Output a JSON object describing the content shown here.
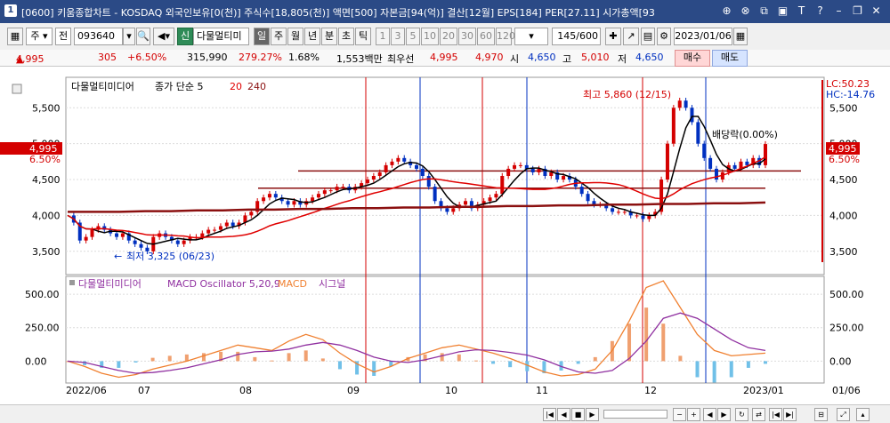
{
  "window": {
    "icon_label": "1",
    "title": "[0600] 키움종합차트 - KOSDAQ 외국인보유[0(천)] 주식수[18,805(천)] 액면[500] 자본금[94(억)] 결산[12월] EPS[184] PER[27.11] 시가총액[93"
  },
  "toolbar": {
    "stock_code": "093640",
    "stock_name": "다물멀티미",
    "new_badge": "신",
    "mode_label": "주",
    "prev_label": "전",
    "periods": [
      "일",
      "주",
      "월",
      "년",
      "분",
      "초",
      "틱"
    ],
    "intervals": [
      "1",
      "3",
      "5",
      "10",
      "20",
      "30",
      "60",
      "120"
    ],
    "count_value": "145",
    "count_total": "/600",
    "date_value": "2023/01/06"
  },
  "quote": {
    "price": "4,995",
    "change": "305",
    "change_pct": "+6.50%",
    "volume": "315,990",
    "volume_pct": "279.27%",
    "turnover": "1.68%",
    "amount": "1,553백만",
    "best_ask_label": "최우선",
    "best_ask": "4,995",
    "best_bid": "4,970",
    "open_label": "시",
    "open": "4,650",
    "high_label": "고",
    "high": "5,010",
    "low_label": "저",
    "low": "4,650",
    "buy_label": "매수",
    "sell_label": "매도"
  },
  "price_panel": {
    "legend_name": "다물멀티미디어",
    "legend_ma": "종가 단순 5",
    "legend_p1": "20",
    "legend_p2": "240",
    "high_annotation": "최고 5,860 (12/15)",
    "low_annotation": "최저 3,325 (06/23)",
    "event_annotation": "배당락(0.00%)",
    "lc_label": "LC:50.23",
    "hc_label": "HC:-14.76",
    "current_price_tag": "4,995",
    "current_pct_tag": "6.50%",
    "y_ticks": [
      "5,500",
      "5,000",
      "4,500",
      "4,000",
      "3,500"
    ]
  },
  "macd_panel": {
    "legend_name": "다물멀티미디어",
    "legend_osc": "MACD Oscillator 5,20,9",
    "legend_macd": "MACD",
    "legend_signal": "시그널",
    "y_ticks": [
      "500.00",
      "250.00",
      "0.00"
    ]
  },
  "x_axis": {
    "labels": [
      "2022/06",
      "07",
      "08",
      "09",
      "10",
      "11",
      "12",
      "2023/01",
      "01/06"
    ]
  },
  "colors": {
    "up": "#d40000",
    "down": "#0030c0",
    "ma5": "#000000",
    "ma20": "#e00000",
    "ma240": "#8b1010",
    "macd": "#f08030",
    "signal": "#9030a0",
    "title_bar": "#2b4a86"
  },
  "chart_data": {
    "type": "candlestick",
    "price_range": [
      3200,
      5900
    ],
    "macd_range": [
      -150,
      620
    ],
    "x_labels": [
      "2022/06",
      "07",
      "08",
      "09",
      "10",
      "11",
      "12",
      "2023/01"
    ],
    "closes": [
      4000,
      3900,
      3650,
      3700,
      3800,
      3850,
      3800,
      3750,
      3700,
      3750,
      3650,
      3600,
      3550,
      3500,
      3700,
      3750,
      3700,
      3650,
      3600,
      3650,
      3700,
      3700,
      3750,
      3800,
      3800,
      3850,
      3900,
      3850,
      3900,
      4000,
      4050,
      4200,
      4250,
      4300,
      4250,
      4200,
      4150,
      4200,
      4150,
      4200,
      4250,
      4300,
      4350,
      4350,
      4400,
      4400,
      4350,
      4400,
      4450,
      4500,
      4550,
      4600,
      4700,
      4750,
      4800,
      4750,
      4700,
      4650,
      4550,
      4400,
      4200,
      4100,
      4050,
      4100,
      4150,
      4200,
      4100,
      4150,
      4200,
      4250,
      4300,
      4550,
      4650,
      4700,
      4700,
      4650,
      4600,
      4650,
      4550,
      4600,
      4500,
      4550,
      4500,
      4400,
      4300,
      4200,
      4150,
      4150,
      4100,
      4050,
      4050,
      4050,
      4000,
      4000,
      3950,
      4000,
      4050,
      4500,
      5000,
      5500,
      5600,
      5500,
      5300,
      5000,
      4800,
      4650,
      4500,
      4600,
      4700,
      4650,
      4750,
      4700,
      4800,
      4700,
      4995
    ],
    "ma240": [
      4050,
      4050,
      4050,
      4060,
      4060,
      4070,
      4070,
      4080,
      4080,
      4090,
      4090,
      4100,
      4100,
      4110,
      4110,
      4120,
      4120,
      4130,
      4130,
      4140,
      4140,
      4150,
      4150,
      4160,
      4160,
      4170,
      4170,
      4180
    ],
    "macd": [
      0,
      -40,
      -90,
      -120,
      -100,
      -60,
      -30,
      0,
      40,
      80,
      120,
      100,
      80,
      150,
      200,
      160,
      60,
      -20,
      -80,
      -40,
      20,
      60,
      100,
      120,
      90,
      60,
      20,
      -30,
      -80,
      -110,
      -100,
      -60,
      80,
      300,
      550,
      600,
      400,
      200,
      80,
      40,
      50,
      60
    ],
    "signal": [
      0,
      -10,
      -40,
      -70,
      -90,
      -85,
      -70,
      -50,
      -20,
      10,
      50,
      70,
      75,
      90,
      120,
      140,
      120,
      80,
      30,
      0,
      -10,
      10,
      40,
      70,
      85,
      80,
      65,
      45,
      10,
      -40,
      -80,
      -90,
      -70,
      20,
      150,
      320,
      360,
      320,
      240,
      160,
      100,
      80
    ]
  }
}
